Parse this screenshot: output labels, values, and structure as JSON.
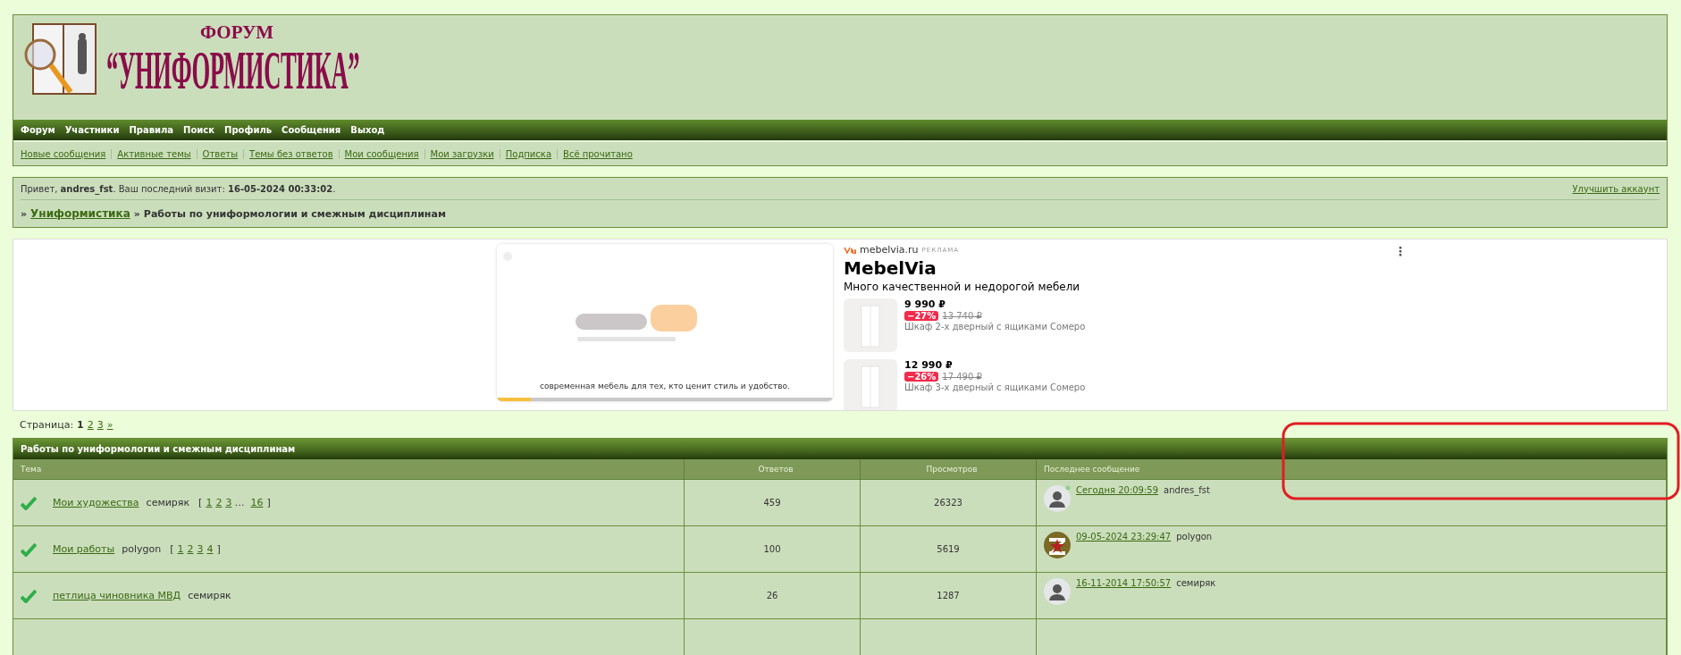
{
  "logo": {
    "small": "ФОРУМ",
    "big": "“УНИФОРМИСТИКА”"
  },
  "nav": [
    "Форум",
    "Участники",
    "Правила",
    "Поиск",
    "Профиль",
    "Сообщения",
    "Выход"
  ],
  "subnav": [
    "Новые сообщения",
    "Активные темы",
    "Ответы",
    "Темы без ответов",
    "Мои сообщения",
    "Мои загрузки",
    "Подписка",
    "Всё прочитано"
  ],
  "welcome": {
    "text": "Привет, **andres_fst**.  Ваш последний визит: **16-05-2024 00:33:02**.",
    "upgrade_link": "Улучшить аккаунт"
  },
  "breadcrumb": {
    "sep": "»",
    "home": "Униформистика",
    "current": "Работы по униформологии и смежным дисциплинам"
  },
  "ad": {
    "caption": "современная мебель для тех, кто ценит стиль и удобство.",
    "progress": {
      "level": 0.1
    },
    "domain": "mebelvia.ru",
    "label": "РЕКЛАМА",
    "title": "MebelVia",
    "subtitle": "Много качественной и недорогой мебели",
    "menu": "⋮",
    "products": [
      {
        "price": "9 990 ₽",
        "discount": "−27%",
        "old_price": "13 740 ₽",
        "name": "Шкаф 2-х дверный с ящиками Сомеро"
      },
      {
        "price": "12 990 ₽",
        "discount": "−26%",
        "old_price": "17 490 ₽",
        "name": "Шкаф 3-х дверный с ящиками Сомеро"
      }
    ]
  },
  "pagination": {
    "label": "Страница:",
    "pages": [
      {
        "label": "1",
        "selected": true
      },
      {
        "label": "2",
        "selected": false
      },
      {
        "label": "3",
        "selected": false
      }
    ],
    "next": "»"
  },
  "table": {
    "title": "Работы по униформологии и смежным дисциплинам",
    "columns": [
      "Тема",
      "Ответов",
      "Просмотров",
      "Последнее сообщение"
    ],
    "page_brackets": [
      "[",
      "]"
    ],
    "rows": [
      {
        "topic": "Мои художества",
        "author": "семиряк",
        "pages": [
          "1",
          "2",
          "3",
          "…",
          "16"
        ],
        "replies": "459",
        "views": "26323",
        "last_time": "Сегодня 20:09:59",
        "last_user": "andres_fst",
        "kind": "silhouette",
        "online": true
      },
      {
        "topic": "Мои работы",
        "author": "polygon",
        "pages": [
          "1",
          "2",
          "3",
          "4"
        ],
        "replies": "100",
        "views": "5619",
        "last_time": "09-05-2024 23:29:47",
        "last_user": "polygon",
        "kind": "picture",
        "online": false
      },
      {
        "topic": "петлица чиновника МВД",
        "author": "семиряк",
        "pages": [],
        "replies": "26",
        "views": "1287",
        "last_time": "16-11-2014 17:50:57",
        "last_user": "семиряк",
        "kind": "silhouette",
        "online": false
      }
    ]
  }
}
